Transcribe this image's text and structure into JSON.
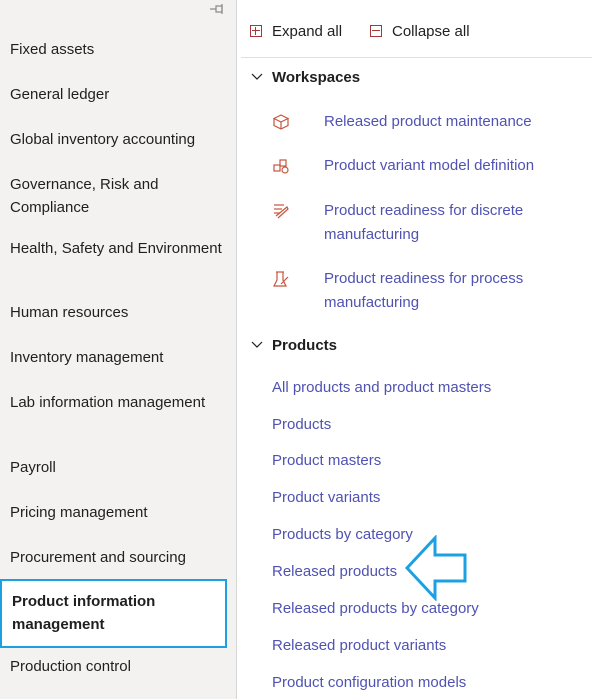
{
  "nav": {
    "pin_icon": "pin-icon",
    "items": [
      {
        "label": "Fixed assets"
      },
      {
        "label": "General ledger"
      },
      {
        "label": "Global inventory accounting"
      },
      {
        "label": "Governance, Risk and Compliance"
      },
      {
        "label": "Health, Safety and Environment"
      },
      {
        "label": "Human resources"
      },
      {
        "label": "Inventory management"
      },
      {
        "label": "Lab information management"
      },
      {
        "label": "Payroll"
      },
      {
        "label": "Pricing management"
      },
      {
        "label": "Procurement and sourcing"
      },
      {
        "label": "Product information management",
        "selected": true
      },
      {
        "label": "Production control"
      }
    ]
  },
  "toolbar": {
    "expand_label": "Expand all",
    "collapse_label": "Collapse all"
  },
  "workspaces": {
    "title": "Workspaces",
    "items": [
      {
        "label": "Released product maintenance",
        "icon": "box-icon"
      },
      {
        "label": "Product variant model definition",
        "icon": "variant-model-icon"
      },
      {
        "label": "Product readiness for discrete manufacturing",
        "icon": "discrete-readiness-icon"
      },
      {
        "label": "Product readiness for process manufacturing",
        "icon": "process-readiness-icon"
      }
    ]
  },
  "products": {
    "title": "Products",
    "items": [
      {
        "label": "All products and product masters"
      },
      {
        "label": "Products"
      },
      {
        "label": "Product masters"
      },
      {
        "label": "Product variants"
      },
      {
        "label": "Products by category"
      },
      {
        "label": "Released products",
        "highlighted": true
      },
      {
        "label": "Released products by category"
      },
      {
        "label": "Released product variants"
      },
      {
        "label": "Product configuration models"
      }
    ]
  },
  "colors": {
    "link": "#4f52b2",
    "selection_border": "#1ba1e2",
    "icon_accent": "#c8553d",
    "callout_arrow": "#1ba1e2"
  }
}
